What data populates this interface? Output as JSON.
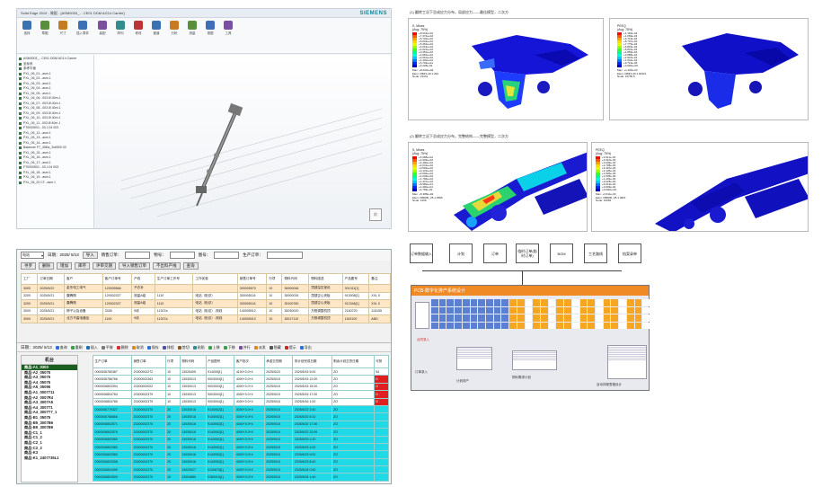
{
  "cad": {
    "title": "Solid Edge 2019 - 装配 - [ASM0003_... CE01 DDM AG14 Carrier]",
    "brand": "SIEMENS",
    "ribbon": [
      {
        "label": "选择",
        "color": "#3b6fb6"
      },
      {
        "label": "草图",
        "color": "#5a8f3c"
      },
      {
        "label": "尺寸",
        "color": "#c57b21"
      },
      {
        "label": "插入零件",
        "color": "#3b6fb6"
      },
      {
        "label": "装配",
        "color": "#7a4fa0"
      },
      {
        "label": "阵列",
        "color": "#2f8f8f"
      },
      {
        "label": "修改",
        "color": "#b33"
      },
      {
        "label": "管道",
        "color": "#3b6fb6"
      },
      {
        "label": "分析",
        "color": "#c57b21"
      },
      {
        "label": "测量",
        "color": "#5a8f3c"
      },
      {
        "label": "视图",
        "color": "#3b6fb6"
      },
      {
        "label": "工具",
        "color": "#7a4fa0"
      }
    ],
    "tree": [
      "ASM0003_...CE01 DDM AG14 Carrier",
      "坐标系",
      "参考平面",
      "PXL_06_01...asm.1",
      "PXL_06_02...asm.1",
      "PXL_06_03...asm.1",
      "PXL_06_04...asm.1",
      "PXL_06_05...asm.1",
      "PXL_06_06...003 Ø.40m.1",
      "PXL_06_07...003 Ø.40m.1",
      "PXL_06_08...003 Ø.40m.1",
      "PXL_06_09...003 Ø.40m.1",
      "PXL_06_10...003 Ø.40m.1",
      "PXL_06_11...003 Ø.40m.1",
      "FT0000501...03 J.04 003",
      "PXL_06_12...asm.1",
      "PXL_06_13...asm.1",
      "PXL_06_14...asm.1",
      "Balancer FT_45lbs_3x6500 00",
      "PXL_06_15...asm.1",
      "PXL_06_16...asm.1",
      "PXL_06_17...asm.1",
      "FT0000501...03 J.04 003",
      "PXL_06_18...asm.1",
      "PXL_06_19...asm.1",
      "PXL_06_20 CT...asm.1"
    ],
    "view_label": "前"
  },
  "fea": {
    "caption_top": "(1) 翻转工况下总成应力分布，局部应力——最佳模型，二次方",
    "caption_bottom": "(2) 翻转工况下总成应力分布，完整结构——完整模型，二次方",
    "legend_left": {
      "title1": "S, Mises",
      "title2": "(Avg: 75%)",
      "values": [
        "+8.043e+02",
        "+7.372e+02",
        "+6.702e+02",
        "+6.032e+02",
        "+5.362e+02",
        "+4.691e+02",
        "+4.021e+02",
        "+3.351e+02",
        "+2.681e+02",
        "+2.010e+02",
        "+1.340e+02",
        "+6.702e+01",
        "+3.228e-02"
      ],
      "max": "Max: +8.043e+02",
      "elem": "Elem: RB4S-49.1.294",
      "node": "Node: 21341"
    },
    "legend_right": {
      "title1": "PEEQ",
      "title2": "(Avg: 75%)",
      "values": [
        "+1.166e-03",
        "+1.069e-03",
        "+9.719e-04",
        "+8.747e-04",
        "+7.775e-04",
        "+6.803e-04",
        "+5.831e-04",
        "+4.859e-04",
        "+3.888e-04",
        "+2.916e-04",
        "+1.944e-04",
        "+9.719e-05",
        "+0.000e+00"
      ],
      "max": "Max: +1.166e-03",
      "elem": "Elem: RB4S-49.1.60321",
      "node": "Node: 10750.5"
    },
    "legend_left2": {
      "title1": "S, Mises",
      "title2": "(Avg: 75%)",
      "values": [
        "+5.388e+02",
        "+4.939e+02",
        "+4.490e+02",
        "+4.041e+02",
        "+3.592e+02",
        "+3.143e+02",
        "+2.694e+02",
        "+2.245e+02",
        "+1.796e+02",
        "+1.347e+02",
        "+8.980e+01",
        "+4.490e+01",
        "+4.799e-02"
      ],
      "max": "Max: +5.388e+02",
      "elem": "Elem: RB00B_V8-1.3586",
      "node": "Node: 1299"
    },
    "legend_right2": {
      "title1": "PEEQ",
      "title2": "(Avg: 75%)",
      "values": [
        "+3.611e-03",
        "+3.310e-03",
        "+3.009e-03",
        "+2.708e-03",
        "+2.407e-03",
        "+2.106e-03",
        "+1.806e-03",
        "+1.505e-03",
        "+1.204e-03",
        "+9.028e-04",
        "+6.019e-04",
        "+3.009e-04",
        "+0.000e+00"
      ],
      "max": "Max: +3.611e-03",
      "elem": "Elem: RB00B_V8-1.4821",
      "node": "Node: 10963"
    },
    "palette": [
      "#ff0000",
      "#ff5a00",
      "#ffa000",
      "#ffd800",
      "#e6ff00",
      "#9cff00",
      "#3cff2a",
      "#00ff8c",
      "#00ffd8",
      "#00c8ff",
      "#0078ff",
      "#0028ff",
      "#0000c8"
    ]
  },
  "erp": {
    "factory_select": "电站",
    "date_label": "日期：2025/ 5/13",
    "import_btn": "导入",
    "sales_order_label": "销售订单：",
    "material_label": "物号：",
    "drawing_label": "图号：",
    "prod_order_label": "生产订单：",
    "buttons_row2": [
      "寻罗",
      "删除",
      "增加",
      "库存",
      "评审交期",
      "导入销售订单",
      "不出料产线",
      "查询"
    ],
    "top_headers": [
      "工厂",
      "订单日期",
      "客户",
      "客户订单号",
      "产线",
      "生产订单工作号",
      "工作优惠",
      "销售订单号",
      "行项",
      "物料代码",
      "物料描述",
      "产品图号",
      "备注"
    ],
    "top_rows": [
      [
        "3000",
        "2025/5/22",
        "金东电工电气",
        "123005566",
        "不去补",
        "",
        "",
        "300005570",
        "10",
        "30000046",
        "顶颈溢压室设",
        "301311[1]",
        ""
      ],
      [
        "3200",
        "2025/5/21",
        "康腾刚",
        "120002327",
        "测量A组",
        "1110",
        "电站（柜总）",
        "300005116",
        "10",
        "30000034",
        "顶颈空心夹板",
        "913008[1]",
        "XXL 0"
      ],
      [
        "3200",
        "2025/5/21",
        "康腾刚",
        "120002327",
        "测量A组",
        "1110",
        "电站（柜总）",
        "300005116",
        "10",
        "30100780",
        "顶颈空心夹板",
        "912346[1]",
        "XXL 0"
      ],
      [
        "3000",
        "2025/5/21",
        "神子以及设备",
        "3336",
        "9线",
        "11307a",
        "电站（柜总）-测线",
        "140005012",
        "10",
        "30030020",
        "方程调整机顶",
        "2160720",
        "115155"
      ],
      [
        "3000",
        "2025/5/21",
        "北方不高电器品",
        "1100",
        "9线",
        "11307a",
        "电站（柜总）-测线",
        "140005012",
        "10",
        "30017110",
        "方程调整机顶",
        "1163100",
        "ABD"
      ]
    ],
    "date2_label": "日期：2025/ 5/13",
    "toolbar": [
      {
        "label": "查询",
        "color": "#2f6fd6"
      },
      {
        "label": "重刷",
        "color": "#3aa14a"
      },
      {
        "label": "插入",
        "color": "#1f6fb3"
      },
      {
        "label": "平移",
        "color": "#7a7a7a"
      },
      {
        "label": "删除",
        "color": "#d32f2f"
      },
      {
        "label": "取消",
        "color": "#d88a1a"
      },
      {
        "label": "保存",
        "color": "#2f6fd6"
      },
      {
        "label": "排程",
        "color": "#4f4f9f"
      },
      {
        "label": "剪切",
        "color": "#8a5a2a"
      },
      {
        "label": "粘贴",
        "color": "#2f8f8f"
      },
      {
        "label": "上移",
        "color": "#3aa14a"
      },
      {
        "label": "下移",
        "color": "#3aa14a"
      },
      {
        "label": "并行",
        "color": "#7a4fa0"
      },
      {
        "label": "派发",
        "color": "#d88a1a"
      },
      {
        "label": "隐藏",
        "color": "#555"
      },
      {
        "label": "提示",
        "color": "#c62828"
      },
      {
        "label": "导出",
        "color": "#2f6fd6"
      }
    ],
    "machine_header": "机台",
    "machines": [
      "商品-A1_0303",
      "商品-A2_05075",
      "商品-A3_05075",
      "商品-A4_05075",
      "商品-A5_05096",
      "商品-A1_0007711",
      "商品-A2_0007R4",
      "商品-A3_3007A5",
      "商品-A4_3007T1",
      "商品-A4_3007T7_1",
      "商品-B1_05075",
      "商品-B5_3007B6",
      "商品-B9_3007B9",
      "商品-C1_1",
      "商品-C1_2",
      "商品-C2_1",
      "商品-C2_2",
      "商品-K3",
      "商品-K1_2407735L1"
    ],
    "grid_headers": [
      "生产订单",
      "销售订单",
      "行项",
      "物料代码",
      "产品图号",
      "客户批次",
      "承诺交货期",
      "排计划完成日期",
      "剩余计划交货日期",
      "可排"
    ],
    "grid_rows": [
      [
        "0000006780387",
        "20200002272",
        "10",
        "13025405",
        "914005[1]",
        "4100+3.0+4",
        "2025/5/23",
        "2025/5/15 5:00",
        "ZO",
        "54"
      ],
      [
        "0000006786766",
        "20200002363",
        "10",
        "13030013",
        "9003004[1]",
        "4000+3.0+4",
        "2025/5/15",
        "2025/5/15 12:00",
        "ZO",
        "D"
      ],
      [
        "0000006803394",
        "20200002002",
        "10",
        "13030013",
        "9003004[1]",
        "4000+3.0+4",
        "2025/5/15",
        "2025/5/15 15:00",
        "ZO",
        "D"
      ],
      [
        "0000006804784",
        "20200002379",
        "10",
        "13030013",
        "9003004[1]",
        "4000+3.0+4",
        "2025/5/15",
        "2025/5/15 17:00",
        "ZO",
        "D"
      ],
      [
        "0000006804785",
        "20200002379",
        "10",
        "13030013",
        "9003004[1]",
        "4000+3.0+4",
        "2025/5/16",
        "2025/5/16 1:00",
        "ZO",
        "D"
      ],
      [
        "0000006779327",
        "20200002370",
        "20",
        "13030016",
        "9140052[1]",
        "4000+3.0+4",
        "2025/5/15",
        "2025/5/22 2:40",
        "ZO",
        ""
      ],
      [
        "0000006786866",
        "20200002370",
        "20",
        "13030016",
        "9140052[1]",
        "4000+3.0+4",
        "2025/5/15",
        "2025/5/22 5:10",
        "ZO",
        ""
      ],
      [
        "0000006802571",
        "20200002370",
        "20",
        "13030016",
        "9140052[1]",
        "4000+3.0+4",
        "2025/5/15",
        "2025/5/22 17:30",
        "ZO",
        ""
      ],
      [
        "0000006802576",
        "20200002370",
        "20",
        "13030016",
        "9140052[1]",
        "4000+3.0+4",
        "2025/5/15",
        "2025/5/22 22:00",
        "ZO",
        ""
      ],
      [
        "0000006802580",
        "20200002370",
        "20",
        "13030016",
        "9140052[1]",
        "4000+3.0+4",
        "2025/5/15",
        "2025/5/23 1:20",
        "ZO",
        ""
      ],
      [
        "0000006802580",
        "20200002370",
        "20",
        "13030016",
        "9140052[1]",
        "4000+3.0+4",
        "2025/5/15",
        "2025/5/23 4:00",
        "ZO",
        ""
      ],
      [
        "0000006802580",
        "20200002370",
        "20",
        "13030016",
        "9140052[1]",
        "4000+3.0+4",
        "2025/5/15",
        "2025/5/23 9:00",
        "ZO",
        ""
      ],
      [
        "0000006803308",
        "20200002370",
        "20",
        "13030016",
        "9140052[1]",
        "4000+3.0+4",
        "2025/5/15",
        "2025/5/23 8:40",
        "ZO",
        ""
      ],
      [
        "0000006804499",
        "20200002370",
        "20",
        "13020027",
        "9130675[1]",
        "4000+3.0+4",
        "2025/5/15",
        "2025/5/24 0:40",
        "ZO",
        ""
      ],
      [
        "0000006804509",
        "20200002370",
        "10",
        "13004880",
        "9180016[1]",
        "4000+3.0+4",
        "2025/5/16",
        "2025/5/24 1:40",
        "ZO",
        ""
      ]
    ]
  },
  "flow": {
    "boxes": [
      "订单数据输入",
      "计划",
      "订单",
      "临时订单(临时订单)",
      "BOM",
      "工艺路线",
      "档案录单"
    ],
    "screen_title": "PCB-数字化排产系统设计",
    "note1": "订单录入",
    "note2": "计划排产",
    "note3": "物料需求计划",
    "note4": "自动排程表格设计",
    "note5": "合同录入"
  }
}
